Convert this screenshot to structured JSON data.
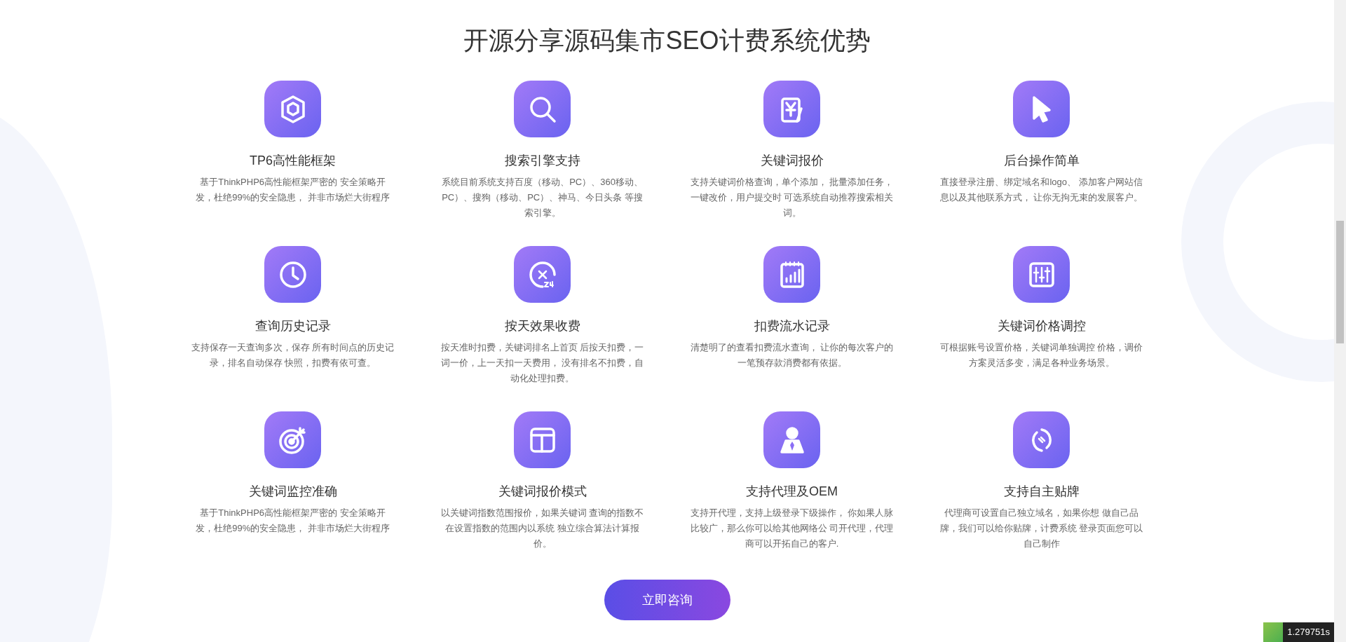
{
  "section": {
    "title": "开源分享源码集市SEO计费系统优势"
  },
  "features": [
    {
      "title": "TP6高性能框架",
      "description": "基于ThinkPHP6高性能框架严密的 安全策略开发，杜绝99%的安全隐患， 并非市场烂大街程序"
    },
    {
      "title": "搜索引擎支持",
      "description": "系统目前系统支持百度（移动、PC）、360移动、PC）、搜狗（移动、PC）、神马、今日头条 等搜索引擎。"
    },
    {
      "title": "关键词报价",
      "description": "支持关键词价格查询，单个添加， 批量添加任务，一键改价，用户提交时 可选系统自动推荐搜索相关词。"
    },
    {
      "title": "后台操作简单",
      "description": "直接登录注册、绑定域名和logo、 添加客户网站信息以及其他联系方式， 让你无拘无束的发展客户。"
    },
    {
      "title": "查询历史记录",
      "description": "支持保存一天查询多次，保存 所有时间点的历史记录，排名自动保存 快照，扣费有依可查。"
    },
    {
      "title": "按天效果收费",
      "description": "按天准时扣费，关键词排名上首页 后按天扣费，一词一价，上一天扣一天费用， 没有排名不扣费，自动化处理扣费。"
    },
    {
      "title": "扣费流水记录",
      "description": "清楚明了的查看扣费流水查询， 让你的每次客户的一笔预存款消费都有依据。"
    },
    {
      "title": "关键词价格调控",
      "description": "可根据账号设置价格，关键词单独调控 价格，调价方案灵活多变，满足各种业务场景。"
    },
    {
      "title": "关键词监控准确",
      "description": "基于ThinkPHP6高性能框架严密的 安全策略开发，杜绝99%的安全隐患， 并非市场烂大街程序"
    },
    {
      "title": "关键词报价模式",
      "description": "以关键词指数范围报价，如果关键词 查询的指数不在设置指数的范围内以系统 独立综合算法计算报价。"
    },
    {
      "title": "支持代理及OEM",
      "description": "支持开代理，支持上级登录下级操作， 你如果人脉比较广，那么你可以给其他网络公 司开代理，代理商可以开拓自己的客户."
    },
    {
      "title": "支持自主贴牌",
      "description": "代理商可设置自己独立域名，如果你想 做自己品牌，我们可以给你贴牌，计费系统 登录页面您可以自己制作"
    }
  ],
  "cta_button": {
    "label": "立即咨询"
  },
  "debug_timer": {
    "value": "1.279751s"
  }
}
